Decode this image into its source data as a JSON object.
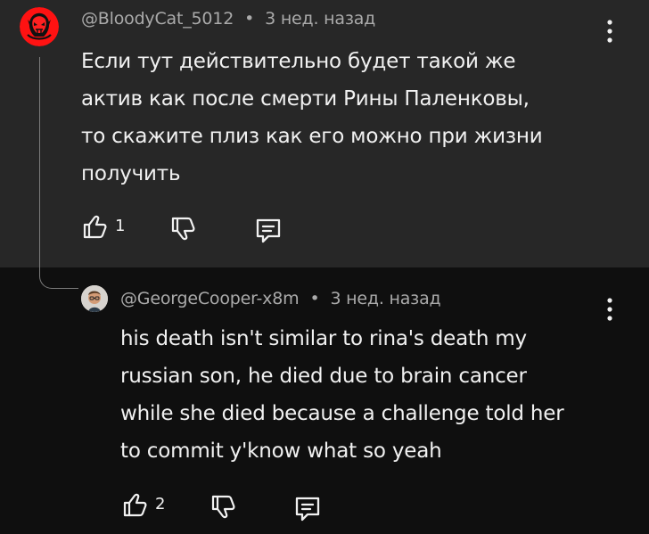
{
  "parent_comment": {
    "author": "@BloodyCat_5012",
    "separator": "•",
    "time": "3 нед. назад",
    "text_lines": [
      "Если тут действительно будет такой же",
      "актив как после смерти Рины Паленковы,",
      "то скажите плиз как его можно при жизни",
      "получить"
    ],
    "likes": "1",
    "avatar_icon": "red-skull-avatar-icon",
    "menu_icon": "more-vertical-icon"
  },
  "reply_comment": {
    "author": "@GeorgeCooper-x8m",
    "separator": "•",
    "time": "3 нед. назад",
    "text_lines": [
      "his death isn't similar to rina's death my",
      "russian son, he died due to brain cancer",
      "while she died because a challenge told her",
      "to commit y'know what so yeah"
    ],
    "likes": "2",
    "avatar_icon": "person-photo-avatar-icon",
    "menu_icon": "more-vertical-icon"
  },
  "icons": {
    "like": "thumbs-up-icon",
    "dislike": "thumbs-down-icon",
    "reply": "reply-comment-icon"
  },
  "colors": {
    "parent_background": "#272727",
    "reply_background": "#0f0f0f",
    "text": "#f1f1f1",
    "meta": "#aaaaaa",
    "thread_line": "#7b7b7b",
    "avatar_red": "#ff1010"
  }
}
